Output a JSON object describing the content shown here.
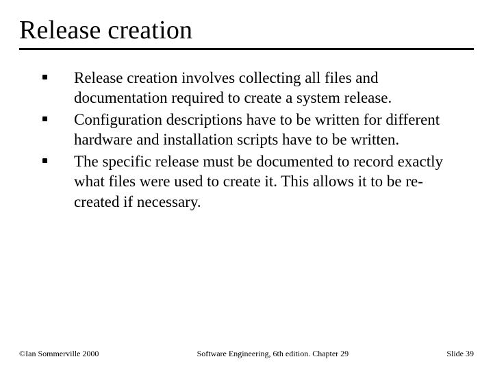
{
  "title": "Release creation",
  "bullets": [
    "Release creation involves collecting all files and documentation required to create a system release.",
    "Configuration descriptions have to be written for different hardware and installation scripts have to be written.",
    "The specific release must be documented to record exactly what files were used to create it. This allows it to be re-created if necessary."
  ],
  "footer": {
    "left": "©Ian Sommerville 2000",
    "center": "Software Engineering, 6th edition. Chapter 29",
    "right": "Slide 39"
  }
}
